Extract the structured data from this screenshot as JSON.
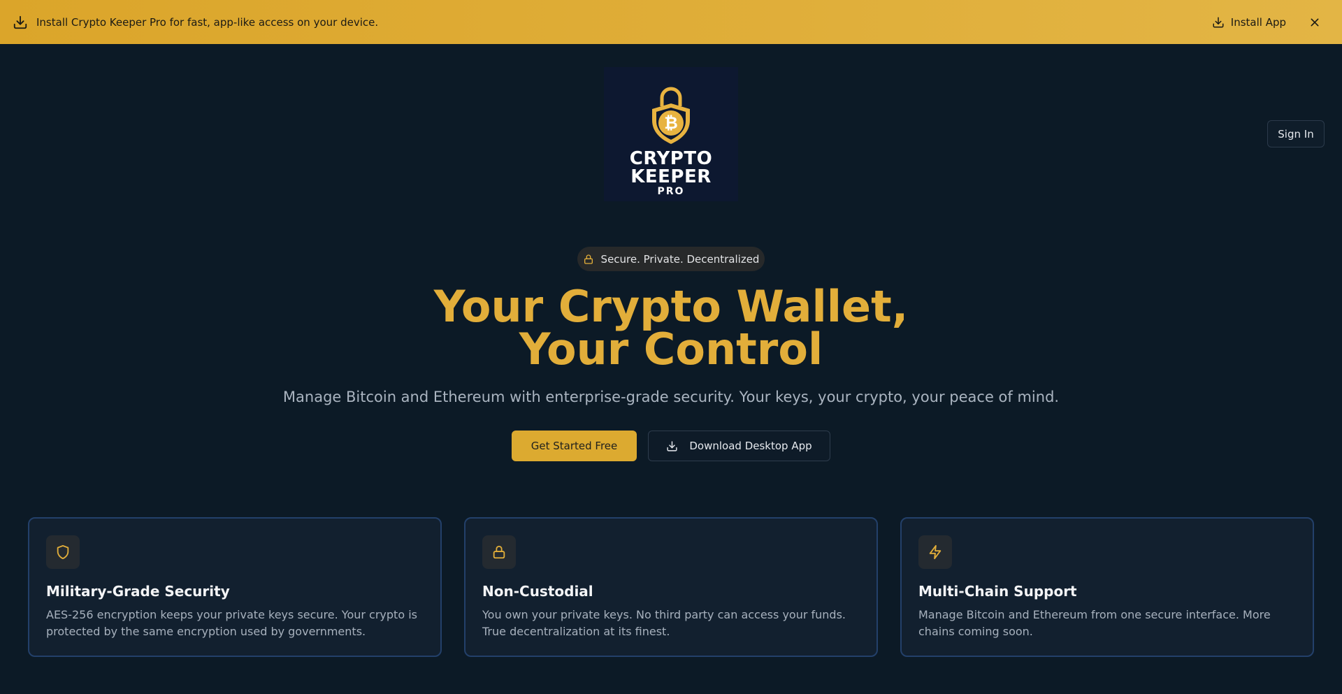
{
  "banner": {
    "message": "Install Crypto Keeper Pro for fast, app-like access on your device.",
    "install_label": "Install App",
    "icons": [
      "download-icon",
      "close-icon"
    ]
  },
  "header": {
    "signin_label": "Sign In"
  },
  "logo": {
    "line1": "CRYPTO",
    "line2": "KEEPER",
    "line3": "PRO",
    "colors": {
      "gold": "#e8b340",
      "bg": "#0d1830"
    }
  },
  "hero": {
    "badge": "Secure. Private. Decentralized",
    "title_line1": "Your Crypto Wallet,",
    "title_line2": "Your Control",
    "subtitle": "Manage Bitcoin and Ethereum with enterprise-grade security. Your keys, your crypto, your peace of mind.",
    "primary_cta": "Get Started Free",
    "secondary_cta": "Download Desktop App"
  },
  "features": [
    {
      "icon": "shield-icon",
      "title": "Military-Grade Security",
      "description": "AES-256 encryption keeps your private keys secure. Your crypto is protected by the same encryption used by governments."
    },
    {
      "icon": "lock-icon",
      "title": "Non-Custodial",
      "description": "You own your private keys. No third party can access your funds. True decentralization at its finest."
    },
    {
      "icon": "lightning-icon",
      "title": "Multi-Chain Support",
      "description": "Manage Bitcoin and Ethereum from one secure interface. More chains coming soon."
    }
  ],
  "colors": {
    "accent": "#e2ae3a",
    "banner": "#dba52a",
    "background": "#0c1a26",
    "card_border": "#23406a"
  }
}
